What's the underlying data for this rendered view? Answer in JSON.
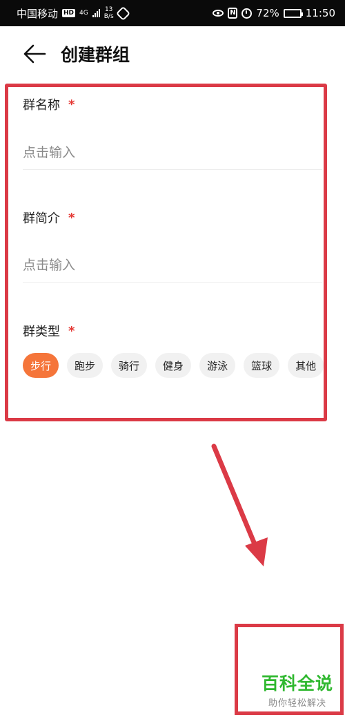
{
  "status_bar": {
    "carrier": "中国移动",
    "hd": "HD",
    "network_type": "4G",
    "speed_value": "13",
    "speed_unit": "B/s",
    "battery": "72%",
    "battery_level": 0.72,
    "time": "11:50"
  },
  "header": {
    "title": "创建群组"
  },
  "form": {
    "name_label": "群名称",
    "name_placeholder": "点击输入",
    "intro_label": "群简介",
    "intro_placeholder": "点击输入",
    "type_label": "群类型",
    "required_mark": "*",
    "types": [
      "步行",
      "跑步",
      "骑行",
      "健身",
      "游泳",
      "篮球",
      "其他"
    ],
    "selected_type": "步行"
  },
  "watermark": {
    "title": "百科全说",
    "subtitle": "助你轻松解决"
  },
  "colors": {
    "accent": "#f5753a",
    "required": "#e53935",
    "annotation": "#db3a46",
    "watermark": "#2fb82f"
  }
}
